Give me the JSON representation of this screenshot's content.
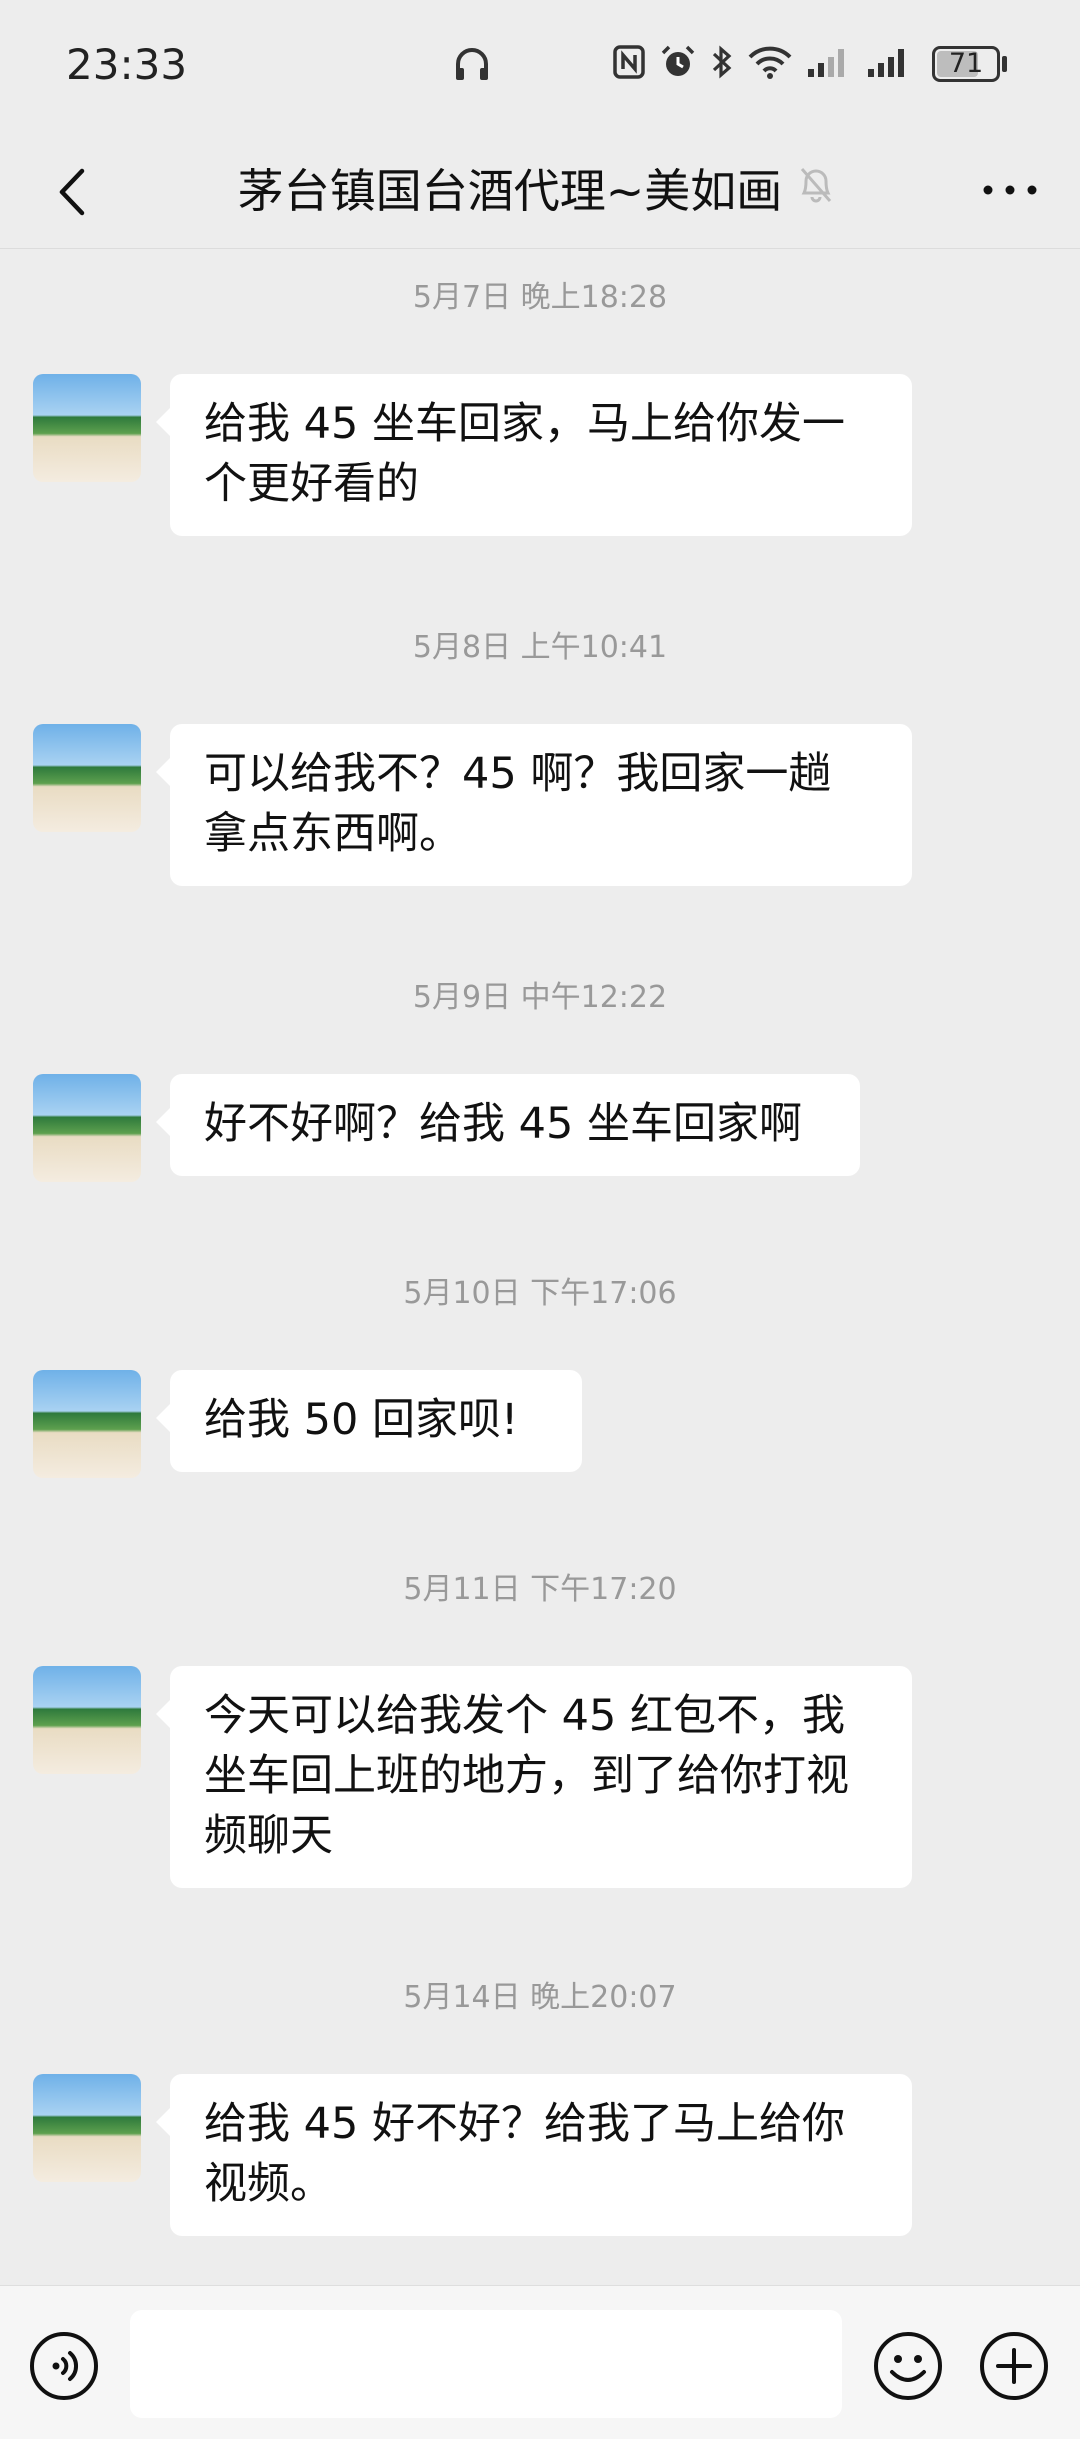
{
  "status_bar": {
    "time": "23:33",
    "battery": "71",
    "battery_level": 0.71,
    "icons": [
      "headphone-icon",
      "nfc-icon",
      "alarm-icon",
      "bluetooth-icon",
      "wifi-icon",
      "signal-icon",
      "signal-icon",
      "battery-icon"
    ]
  },
  "header": {
    "title": "茅台镇国台酒代理~美如画",
    "muted": true
  },
  "messages": [
    {
      "timestamp": "5月7日 晚上18:28",
      "text": "给我 45 坐车回家，马上给你发一\n个更好看的"
    },
    {
      "timestamp": "5月8日 上午10:41",
      "text": "可以给我不？45 啊？我回家一趟\n拿点东西啊。"
    },
    {
      "timestamp": "5月9日 中午12:22",
      "text": "好不好啊？给我 45 坐车回家啊"
    },
    {
      "timestamp": "5月10日 下午17:06",
      "text": "给我 50 回家呗!"
    },
    {
      "timestamp": "5月11日 下午17:20",
      "text": "今天可以给我发个 45 红包不，我\n坐车回上班的地方，到了给你打视\n频聊天"
    },
    {
      "timestamp": "5月14日 晚上20:07",
      "text": "给我 45 好不好？给我了马上给你\n视频。"
    }
  ],
  "input": {
    "value": "",
    "placeholder": ""
  }
}
